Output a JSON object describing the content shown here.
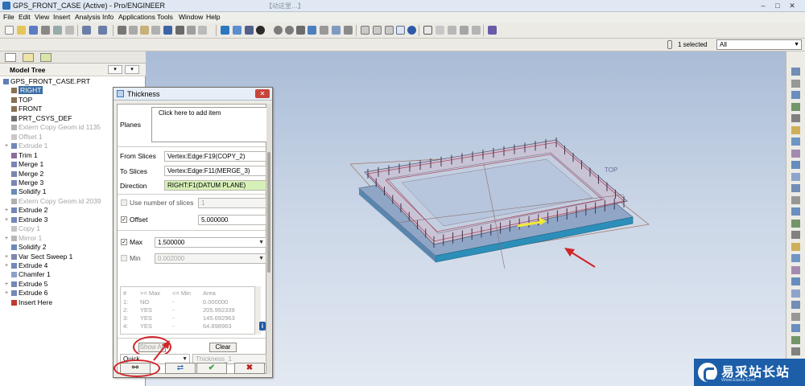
{
  "window": {
    "title": "GPS_FRONT_CASE (Active) - Pro/ENGINEER",
    "title_faint": "【动这里…】",
    "minimize": "–",
    "maximize": "□",
    "close": "✕"
  },
  "menu": [
    "File",
    "Edit",
    "View",
    "Insert",
    "Analysis",
    "Info",
    "Applications",
    "Tools",
    "Window",
    "Help"
  ],
  "selection": {
    "count_text": "1 selected",
    "filter_value": "All"
  },
  "model_tree": {
    "header": "Model Tree",
    "items": [
      {
        "label": "GPS_FRONT_CASE.PRT",
        "dim": false,
        "sel": false,
        "expand": false,
        "icon": "part-icon"
      },
      {
        "label": "RIGHT",
        "dim": false,
        "sel": true,
        "expand": false,
        "icon": "datum-plane-icon"
      },
      {
        "label": "TOP",
        "dim": false,
        "sel": false,
        "expand": false,
        "icon": "datum-plane-icon"
      },
      {
        "label": "FRONT",
        "dim": false,
        "sel": false,
        "expand": false,
        "icon": "datum-plane-icon"
      },
      {
        "label": "PRT_CSYS_DEF",
        "dim": false,
        "sel": false,
        "expand": false,
        "icon": "csys-icon"
      },
      {
        "label": "Extern Copy Geom id 1135",
        "dim": true,
        "sel": false,
        "expand": false,
        "icon": "copy-geom-icon"
      },
      {
        "label": "Offset 1",
        "dim": true,
        "sel": false,
        "expand": false,
        "icon": "offset-icon"
      },
      {
        "label": "Extrude 1",
        "dim": true,
        "sel": false,
        "expand": true,
        "icon": "extrude-icon"
      },
      {
        "label": "Trim 1",
        "dim": false,
        "sel": false,
        "expand": false,
        "icon": "trim-icon"
      },
      {
        "label": "Merge 1",
        "dim": false,
        "sel": false,
        "expand": false,
        "icon": "merge-icon"
      },
      {
        "label": "Merge 2",
        "dim": false,
        "sel": false,
        "expand": false,
        "icon": "merge-icon"
      },
      {
        "label": "Merge 3",
        "dim": false,
        "sel": false,
        "expand": false,
        "icon": "merge-icon"
      },
      {
        "label": "Solidify 1",
        "dim": false,
        "sel": false,
        "expand": false,
        "icon": "solidify-icon"
      },
      {
        "label": "Extern Copy Geom id 2039",
        "dim": true,
        "sel": false,
        "expand": false,
        "icon": "copy-geom-icon"
      },
      {
        "label": "Extrude 2",
        "dim": false,
        "sel": false,
        "expand": true,
        "icon": "extrude-icon"
      },
      {
        "label": "Extrude 3",
        "dim": false,
        "sel": false,
        "expand": true,
        "icon": "extrude-icon"
      },
      {
        "label": "Copy 1",
        "dim": true,
        "sel": false,
        "expand": false,
        "icon": "copy-icon"
      },
      {
        "label": "Mirror 1",
        "dim": true,
        "sel": false,
        "expand": true,
        "icon": "mirror-icon"
      },
      {
        "label": "Solidify 2",
        "dim": false,
        "sel": false,
        "expand": false,
        "icon": "solidify-icon"
      },
      {
        "label": "Var Sect Sweep 1",
        "dim": false,
        "sel": false,
        "expand": true,
        "icon": "sweep-icon"
      },
      {
        "label": "Extrude 4",
        "dim": false,
        "sel": false,
        "expand": true,
        "icon": "extrude-icon"
      },
      {
        "label": "Chamfer 1",
        "dim": false,
        "sel": false,
        "expand": false,
        "icon": "chamfer-icon"
      },
      {
        "label": "Extrude 5",
        "dim": false,
        "sel": false,
        "expand": true,
        "icon": "extrude-icon"
      },
      {
        "label": "Extrude 6",
        "dim": false,
        "sel": false,
        "expand": true,
        "icon": "extrude-icon"
      },
      {
        "label": "Insert Here",
        "dim": false,
        "sel": false,
        "expand": false,
        "icon": "insert-here-icon"
      }
    ]
  },
  "thickness_dialog": {
    "title": "Thickness",
    "planes_label": "Planes",
    "planes_placeholder": "Click here to add item",
    "from_slices_label": "From Slices",
    "from_slices_value": "Vertex:Edge:F19(COPY_2)",
    "to_slices_label": "To Slices",
    "to_slices_value": "Vertex:Edge:F11(MERGE_3)",
    "direction_label": "Direction",
    "direction_value": "RIGHT:F1(DATUM PLANE)",
    "use_num_slices_label": "Use number of slices",
    "num_slices_value": "1",
    "offset_label": "Offset",
    "offset_value": "5.000000",
    "max_label": "Max",
    "max_value": "1.500000",
    "min_label": "Min",
    "min_value": "0.002000",
    "results_headers": [
      "#",
      ">= Max",
      "<= Min",
      "Area"
    ],
    "results_rows": [
      [
        "1:",
        "NO",
        "-",
        "0.000000"
      ],
      [
        "2:",
        "YES",
        "-",
        "205.992339"
      ],
      [
        "3:",
        "YES",
        "-",
        "145.692963"
      ],
      [
        "4:",
        "YES",
        "-",
        "64.898963"
      ]
    ],
    "show_all_label": "Show All",
    "clear_label": "Clear",
    "mode_value": "Quick",
    "name_value": "Thickness_1",
    "info_label": "i"
  },
  "datum_label_top": "TOP",
  "watermark": {
    "text": "易采站长站",
    "sub": "Www.Easck.Com"
  },
  "colors": {
    "highlight": "#d0252a",
    "selection_blue": "#3a6ea5",
    "direction_green": "#d7f0b8"
  }
}
